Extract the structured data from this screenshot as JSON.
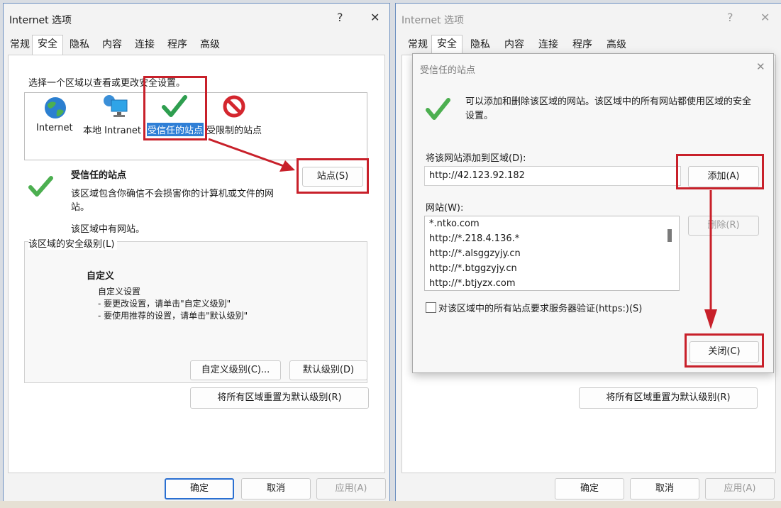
{
  "left": {
    "title": "Internet 选项",
    "help": "?",
    "close": "✕",
    "tabs": [
      "常规",
      "安全",
      "隐私",
      "内容",
      "连接",
      "程序",
      "高级"
    ],
    "zone_prompt": "选择一个区域以查看或更改安全设置。",
    "zones": [
      "Internet",
      "本地 Intranet",
      "受信任的站点",
      "受限制的站点"
    ],
    "zone_title": "受信任的站点",
    "zone_desc": "该区域包含你确信不会损害你的计算机或文件的网站。",
    "zone_note": "该区域中有网站。",
    "sites_btn": "站点(S)",
    "level_group": "该区域的安全级别(L)",
    "custom_title": "自定义",
    "custom_line1": "自定义设置",
    "custom_line2": "- 要更改设置，请单击\"自定义级别\"",
    "custom_line3": "- 要使用推荐的设置，请单击\"默认级别\"",
    "custom_level_btn": "自定义级别(C)...",
    "default_level_btn": "默认级别(D)",
    "reset_all_btn": "将所有区域重置为默认级别(R)",
    "ok": "确定",
    "cancel": "取消",
    "apply": "应用(A)"
  },
  "right": {
    "title": "Internet 选项",
    "help": "?",
    "close": "✕",
    "tabs": [
      "常规",
      "安全",
      "隐私",
      "内容",
      "连接",
      "程序",
      "高级"
    ],
    "reset_all_btn": "将所有区域重置为默认级别(R)",
    "ok": "确定",
    "cancel": "取消",
    "apply": "应用(A)",
    "trusted_dialog": {
      "title": "受信任的站点",
      "close": "✕",
      "desc": "可以添加和删除该区域的网站。该区域中的所有网站都使用区域的安全设置。",
      "add_label": "将该网站添加到区域(D):",
      "add_value": "http://42.123.92.182",
      "add_btn": "添加(A)",
      "sites_label": "网站(W):",
      "sites": [
        "*.ntko.com",
        "http://*.218.4.136.*",
        "http://*.alsggzyjy.cn",
        "http://*.btggzyjy.cn",
        "http://*.btjyzx.com"
      ],
      "remove_btn": "删除(R)",
      "https_check": "对该区域中的所有站点要求服务器验证(https:)(S)",
      "close_btn": "关闭(C)"
    }
  },
  "colors": {
    "annotation": "#c8202a",
    "selection": "#2f7fd6",
    "check": "#4caf50"
  }
}
